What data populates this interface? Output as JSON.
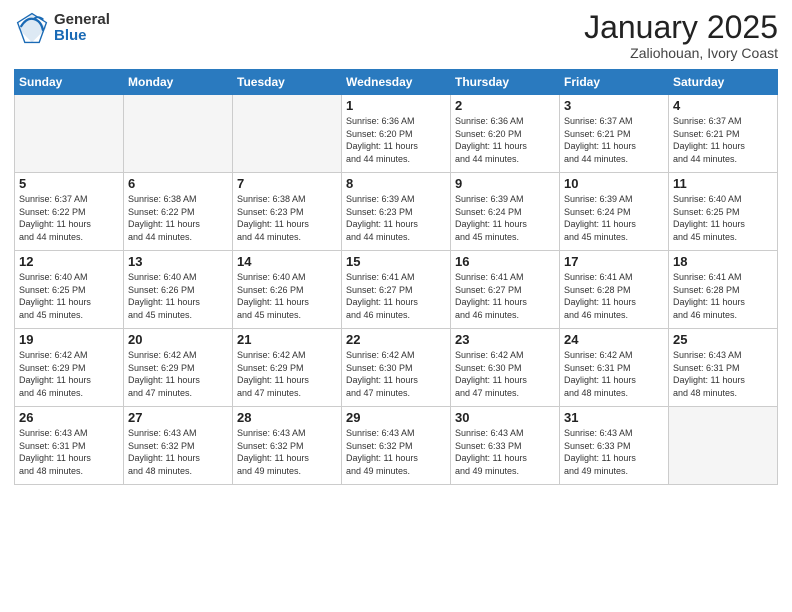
{
  "logo": {
    "general": "General",
    "blue": "Blue"
  },
  "title": {
    "month_year": "January 2025",
    "location": "Zaliohouan, Ivory Coast"
  },
  "days_of_week": [
    "Sunday",
    "Monday",
    "Tuesday",
    "Wednesday",
    "Thursday",
    "Friday",
    "Saturday"
  ],
  "weeks": [
    [
      {
        "day": "",
        "info": ""
      },
      {
        "day": "",
        "info": ""
      },
      {
        "day": "",
        "info": ""
      },
      {
        "day": "1",
        "info": "Sunrise: 6:36 AM\nSunset: 6:20 PM\nDaylight: 11 hours\nand 44 minutes."
      },
      {
        "day": "2",
        "info": "Sunrise: 6:36 AM\nSunset: 6:20 PM\nDaylight: 11 hours\nand 44 minutes."
      },
      {
        "day": "3",
        "info": "Sunrise: 6:37 AM\nSunset: 6:21 PM\nDaylight: 11 hours\nand 44 minutes."
      },
      {
        "day": "4",
        "info": "Sunrise: 6:37 AM\nSunset: 6:21 PM\nDaylight: 11 hours\nand 44 minutes."
      }
    ],
    [
      {
        "day": "5",
        "info": "Sunrise: 6:37 AM\nSunset: 6:22 PM\nDaylight: 11 hours\nand 44 minutes."
      },
      {
        "day": "6",
        "info": "Sunrise: 6:38 AM\nSunset: 6:22 PM\nDaylight: 11 hours\nand 44 minutes."
      },
      {
        "day": "7",
        "info": "Sunrise: 6:38 AM\nSunset: 6:23 PM\nDaylight: 11 hours\nand 44 minutes."
      },
      {
        "day": "8",
        "info": "Sunrise: 6:39 AM\nSunset: 6:23 PM\nDaylight: 11 hours\nand 44 minutes."
      },
      {
        "day": "9",
        "info": "Sunrise: 6:39 AM\nSunset: 6:24 PM\nDaylight: 11 hours\nand 45 minutes."
      },
      {
        "day": "10",
        "info": "Sunrise: 6:39 AM\nSunset: 6:24 PM\nDaylight: 11 hours\nand 45 minutes."
      },
      {
        "day": "11",
        "info": "Sunrise: 6:40 AM\nSunset: 6:25 PM\nDaylight: 11 hours\nand 45 minutes."
      }
    ],
    [
      {
        "day": "12",
        "info": "Sunrise: 6:40 AM\nSunset: 6:25 PM\nDaylight: 11 hours\nand 45 minutes."
      },
      {
        "day": "13",
        "info": "Sunrise: 6:40 AM\nSunset: 6:26 PM\nDaylight: 11 hours\nand 45 minutes."
      },
      {
        "day": "14",
        "info": "Sunrise: 6:40 AM\nSunset: 6:26 PM\nDaylight: 11 hours\nand 45 minutes."
      },
      {
        "day": "15",
        "info": "Sunrise: 6:41 AM\nSunset: 6:27 PM\nDaylight: 11 hours\nand 46 minutes."
      },
      {
        "day": "16",
        "info": "Sunrise: 6:41 AM\nSunset: 6:27 PM\nDaylight: 11 hours\nand 46 minutes."
      },
      {
        "day": "17",
        "info": "Sunrise: 6:41 AM\nSunset: 6:28 PM\nDaylight: 11 hours\nand 46 minutes."
      },
      {
        "day": "18",
        "info": "Sunrise: 6:41 AM\nSunset: 6:28 PM\nDaylight: 11 hours\nand 46 minutes."
      }
    ],
    [
      {
        "day": "19",
        "info": "Sunrise: 6:42 AM\nSunset: 6:29 PM\nDaylight: 11 hours\nand 46 minutes."
      },
      {
        "day": "20",
        "info": "Sunrise: 6:42 AM\nSunset: 6:29 PM\nDaylight: 11 hours\nand 47 minutes."
      },
      {
        "day": "21",
        "info": "Sunrise: 6:42 AM\nSunset: 6:29 PM\nDaylight: 11 hours\nand 47 minutes."
      },
      {
        "day": "22",
        "info": "Sunrise: 6:42 AM\nSunset: 6:30 PM\nDaylight: 11 hours\nand 47 minutes."
      },
      {
        "day": "23",
        "info": "Sunrise: 6:42 AM\nSunset: 6:30 PM\nDaylight: 11 hours\nand 47 minutes."
      },
      {
        "day": "24",
        "info": "Sunrise: 6:42 AM\nSunset: 6:31 PM\nDaylight: 11 hours\nand 48 minutes."
      },
      {
        "day": "25",
        "info": "Sunrise: 6:43 AM\nSunset: 6:31 PM\nDaylight: 11 hours\nand 48 minutes."
      }
    ],
    [
      {
        "day": "26",
        "info": "Sunrise: 6:43 AM\nSunset: 6:31 PM\nDaylight: 11 hours\nand 48 minutes."
      },
      {
        "day": "27",
        "info": "Sunrise: 6:43 AM\nSunset: 6:32 PM\nDaylight: 11 hours\nand 48 minutes."
      },
      {
        "day": "28",
        "info": "Sunrise: 6:43 AM\nSunset: 6:32 PM\nDaylight: 11 hours\nand 49 minutes."
      },
      {
        "day": "29",
        "info": "Sunrise: 6:43 AM\nSunset: 6:32 PM\nDaylight: 11 hours\nand 49 minutes."
      },
      {
        "day": "30",
        "info": "Sunrise: 6:43 AM\nSunset: 6:33 PM\nDaylight: 11 hours\nand 49 minutes."
      },
      {
        "day": "31",
        "info": "Sunrise: 6:43 AM\nSunset: 6:33 PM\nDaylight: 11 hours\nand 49 minutes."
      },
      {
        "day": "",
        "info": ""
      }
    ]
  ]
}
